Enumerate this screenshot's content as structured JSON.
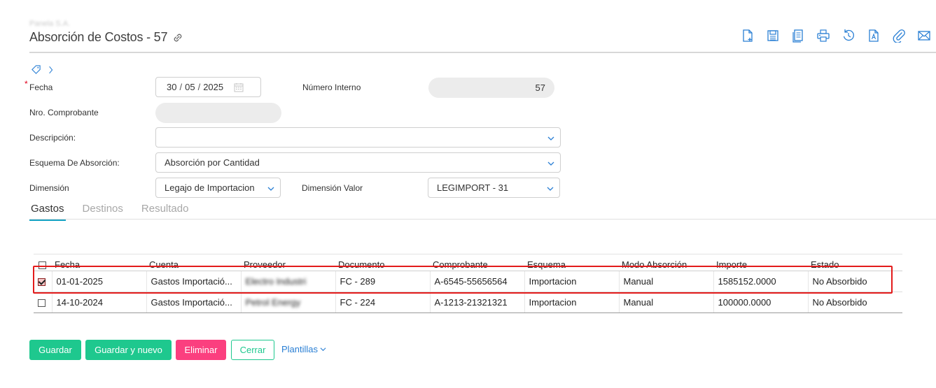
{
  "header": {
    "company": "Panela S.A.",
    "title": "Absorción de Costos - 57",
    "toolbar": [
      {
        "icon": "new-document-icon"
      },
      {
        "icon": "save-icon"
      },
      {
        "icon": "list-document-icon"
      },
      {
        "icon": "print-icon"
      },
      {
        "icon": "history-icon"
      },
      {
        "icon": "font-document-icon"
      },
      {
        "icon": "attach-icon"
      },
      {
        "icon": "mail-icon"
      }
    ]
  },
  "form": {
    "fecha_label": "Fecha",
    "fecha_required": "*",
    "fecha_day": "30",
    "fecha_month": "05",
    "fecha_year": "2025",
    "numero_interno_label": "Número Interno",
    "numero_interno_value": "57",
    "nro_comprobante_label": "Nro. Comprobante",
    "nro_comprobante_value": "",
    "descripcion_label": "Descripción:",
    "descripcion_value": "",
    "esquema_label": "Esquema De Absorción:",
    "esquema_value": "Absorción por Cantidad",
    "dimension_label": "Dimensión",
    "dimension_value": "Legajo de Importacion",
    "dimension_valor_label": "Dimensión Valor",
    "dimension_valor_value": "LEGIMPORT - 31"
  },
  "tabs": [
    {
      "label": "Gastos",
      "active": true
    },
    {
      "label": "Destinos",
      "active": false
    },
    {
      "label": "Resultado",
      "active": false
    }
  ],
  "table": {
    "headers": [
      "Fecha",
      "Cuenta",
      "Proveedor",
      "Documento",
      "Comprobante",
      "Esquema",
      "Modo Absorción",
      "Importe",
      "Estado"
    ],
    "rows": [
      {
        "checked": true,
        "fecha": "01-01-2025",
        "cuenta": "Gastos Importació...",
        "proveedor": "Electro Industri",
        "documento": "FC - 289",
        "comprobante": "A-6545-55656564",
        "esquema": "Importacion",
        "modo": "Manual",
        "importe": "1585152.0000",
        "estado": "No Absorbido"
      },
      {
        "checked": false,
        "fecha": "14-10-2024",
        "cuenta": "Gastos Importació...",
        "proveedor": "Petrol Energy",
        "documento": "FC - 224",
        "comprobante": "A-1213-21321321",
        "esquema": "Importacion",
        "modo": "Manual",
        "importe": "100000.0000",
        "estado": "No Absorbido"
      }
    ]
  },
  "actions": {
    "guardar": "Guardar",
    "guardar_nuevo": "Guardar y nuevo",
    "eliminar": "Eliminar",
    "cerrar": "Cerrar",
    "plantillas": "Plantillas"
  },
  "colors": {
    "accent_green": "#1ec88e",
    "danger_pink": "#fb3f7f",
    "tab_underline": "#16a3c4",
    "link_blue": "#2a7fd4",
    "highlight_red": "#e31b1b"
  }
}
